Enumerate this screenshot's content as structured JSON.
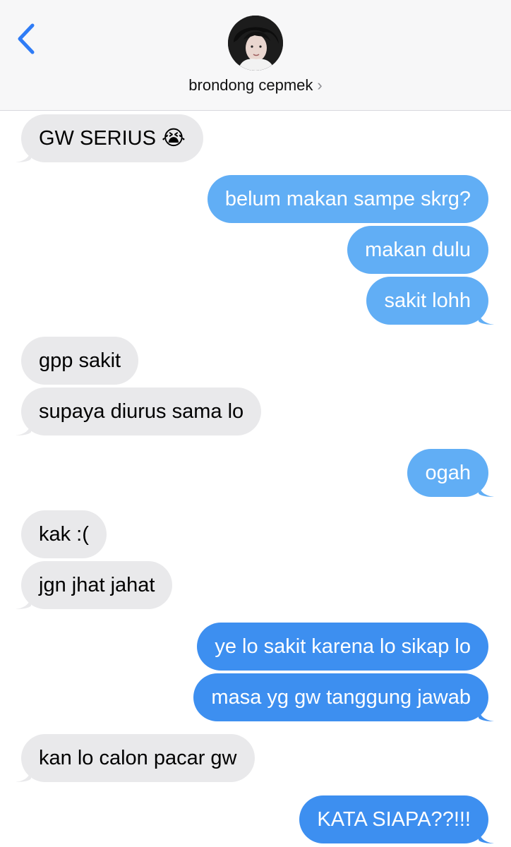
{
  "header": {
    "contact_name": "brondong cepmek",
    "chevron": "›"
  },
  "colors": {
    "incoming_bubble": "#e9e9eb",
    "outgoing_bubble": "#61aef5",
    "outgoing_bubble_deep": "#3d8ff0",
    "accent": "#2f7cf6"
  },
  "messages": [
    {
      "dir": "in",
      "text": "GW SERIUS 😭"
    },
    {
      "dir": "out",
      "text": "belum makan sampe skrg?"
    },
    {
      "dir": "out",
      "text": "makan dulu"
    },
    {
      "dir": "out",
      "text": "sakit lohh"
    },
    {
      "dir": "in",
      "text": "gpp sakit"
    },
    {
      "dir": "in",
      "text": "supaya diurus sama lo"
    },
    {
      "dir": "out",
      "text": "ogah"
    },
    {
      "dir": "in",
      "text": "kak :("
    },
    {
      "dir": "in",
      "text": "jgn jhat jahat"
    },
    {
      "dir": "out",
      "text": "ye lo sakit karena lo sikap lo"
    },
    {
      "dir": "out",
      "text": "masa yg gw tanggung jawab"
    },
    {
      "dir": "in",
      "text": "kan lo calon pacar gw"
    },
    {
      "dir": "out",
      "text": "KATA SIAPA??!!!"
    }
  ]
}
